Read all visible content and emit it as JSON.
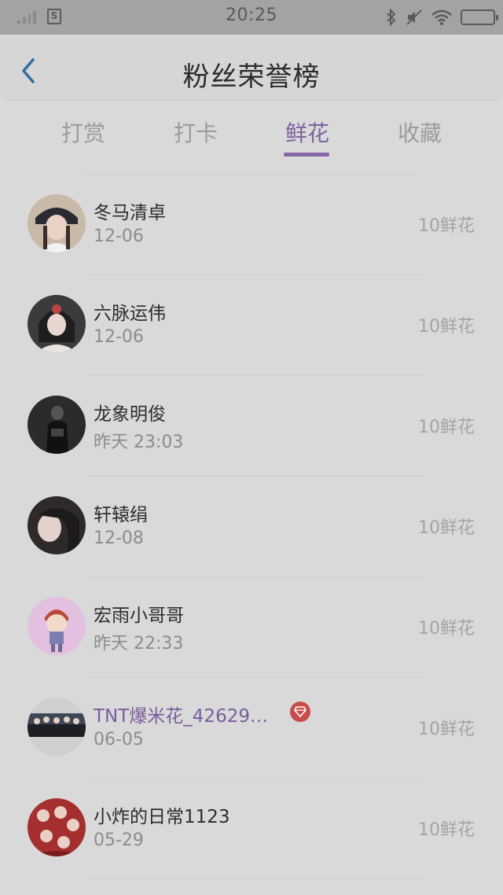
{
  "status_bar": {
    "time": "20:25",
    "sim_icon": "S"
  },
  "header": {
    "title": "粉丝荣誉榜",
    "back_icon": "chevron-left-icon"
  },
  "tabs": [
    {
      "label": "打赏",
      "active": false
    },
    {
      "label": "打卡",
      "active": false
    },
    {
      "label": "鲜花",
      "active": true
    },
    {
      "label": "收藏",
      "active": false
    }
  ],
  "fans": [
    {
      "name": "冬马清卓",
      "date": "12-06",
      "amount": "10鲜花",
      "vip": false
    },
    {
      "name": "六脉运伟",
      "date": "12-06",
      "amount": "10鲜花",
      "vip": false
    },
    {
      "name": "龙象明俊",
      "date": "昨天 23:03",
      "amount": "10鲜花",
      "vip": false
    },
    {
      "name": "轩辕绢",
      "date": "12-08",
      "amount": "10鲜花",
      "vip": false
    },
    {
      "name": "宏雨小哥哥",
      "date": "昨天 22:33",
      "amount": "10鲜花",
      "vip": false
    },
    {
      "name": "TNT爆米花_42629…",
      "date": "06-05",
      "amount": "10鲜花",
      "vip": true
    },
    {
      "name": "小炸的日常1123",
      "date": "05-29",
      "amount": "10鲜花",
      "vip": false
    }
  ],
  "colors": {
    "accent": "#7d61a0",
    "vip_badge": "#c94b4b",
    "back_arrow": "#2f6f9f"
  }
}
